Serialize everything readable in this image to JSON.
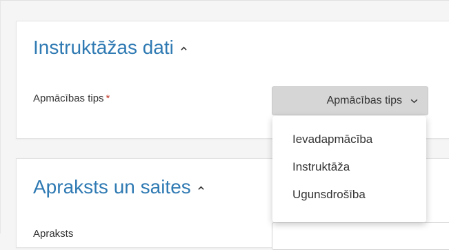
{
  "sections": [
    {
      "title": "Instruktāžas dati",
      "field_label": "Apmācības tips",
      "required_mark": "*",
      "select_value": "Apmācības tips"
    },
    {
      "title": "Apraksts un saites",
      "field_label": "Apraksts"
    }
  ],
  "dropdown": {
    "options": [
      "Ievadapmācība",
      "Instruktāža",
      "Ugunsdrošība"
    ]
  },
  "colors": {
    "title": "#2f7ab3",
    "required": "#c0392b",
    "select_bg": "#d6d6d6"
  },
  "icons": {
    "collapse": "chevron-up-icon",
    "dropdown": "chevron-down-icon"
  }
}
